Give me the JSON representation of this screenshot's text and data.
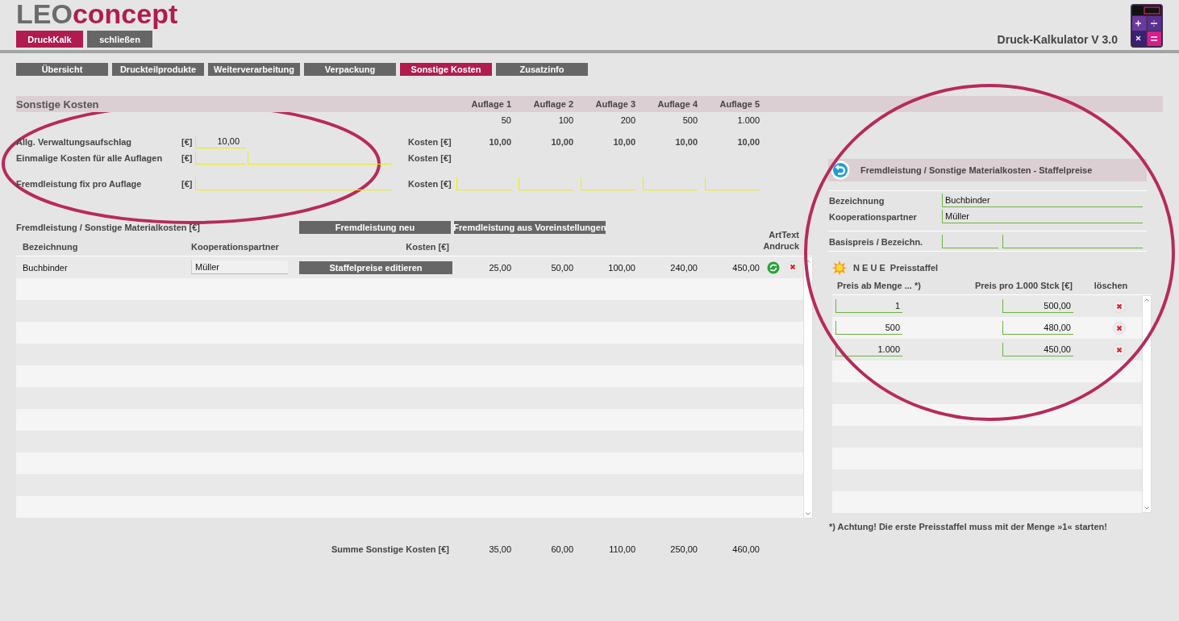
{
  "header": {
    "logo": {
      "part_1": "LEO",
      "part_2": "concept"
    },
    "buttons": [
      {
        "label": "DruckKalk",
        "selected": true
      },
      {
        "label": "schließen",
        "selected": false
      }
    ],
    "app_title": "Druck-Kalkulator V 3.0"
  },
  "tabs": [
    {
      "label": "Übersicht",
      "selected": false
    },
    {
      "label": "Druckteilprodukte",
      "selected": false
    },
    {
      "label": "Weiterverarbeitung",
      "selected": false
    },
    {
      "label": "Verpackung",
      "selected": false
    },
    {
      "label": "Sonstige Kosten",
      "selected": true
    },
    {
      "label": "Zusatzinfo",
      "selected": false
    }
  ],
  "sonstige_kosten": {
    "title": "Sonstige Kosten",
    "auflagen": [
      {
        "label": "Auflage 1",
        "quantity": "50"
      },
      {
        "label": "Auflage 2",
        "quantity": "100"
      },
      {
        "label": "Auflage 3",
        "quantity": "200"
      },
      {
        "label": "Auflage 4",
        "quantity": "500"
      },
      {
        "label": "Auflage 5",
        "quantity": "1.000"
      }
    ],
    "rows": [
      {
        "label": "Allg. Verwaltungsaufschlag",
        "unit": "[€]",
        "kind": "short",
        "value": "10,00",
        "kosten_label": "Kosten [€]",
        "kosten": [
          "10,00",
          "10,00",
          "10,00",
          "10,00",
          "10,00"
        ]
      },
      {
        "label": "Einmalige Kosten für alle Auflagen",
        "unit": "[€]",
        "kind": "short_long",
        "kosten_label": "Kosten [€]"
      },
      {
        "label": "Fremdleistung fix pro Auflage",
        "unit": "[€]",
        "kind": "wide",
        "kosten_label": "Kosten [€]"
      }
    ]
  },
  "fremdleistung": {
    "title": "Fremdleistung /  Sonstige Materialkosten [€]",
    "buttons": [
      "Fremdleistung neu",
      "Fremdleistung aus Voreinstellungen"
    ],
    "columns": [
      "Bezeichnung",
      "Kooperationspartner",
      "Kosten [€]",
      "ArtText Andruck"
    ],
    "rows": [
      {
        "bezeichnung": "Buchbinder",
        "partner": "Müller",
        "action": "Staffelpreise editieren",
        "kosten": [
          "25,00",
          "50,00",
          "100,00",
          "240,00",
          "450,00"
        ]
      }
    ]
  },
  "summe": {
    "label": "Summe Sonstige Kosten [€]",
    "values": [
      "35,00",
      "60,00",
      "110,00",
      "250,00",
      "460,00"
    ]
  },
  "staffelpreise": {
    "title": "Fremdleistung /  Sonstige Materialkosten - Staffelpreise",
    "fields": [
      {
        "label": "Bezeichnung",
        "kind": "single",
        "value": "Buchbinder"
      },
      {
        "label": "Kooperationspartner",
        "kind": "single",
        "value": "Müller"
      },
      {
        "label": "Basispreis / Bezeichn.",
        "kind": "double"
      }
    ],
    "new_spaced": "N E U E",
    "new_label": "Preisstaffel",
    "columns": [
      "Preis ab Menge ... *)",
      "Preis pro 1.000 Stck [€]",
      "löschen"
    ],
    "rows": [
      {
        "menge": "1",
        "preis": "500,00"
      },
      {
        "menge": "500",
        "preis": "480,00"
      },
      {
        "menge": "1.000",
        "preis": "450,00"
      }
    ],
    "note": "*) Achtung! Die erste Preisstaffel muss mit der Menge »1« starten!"
  }
}
